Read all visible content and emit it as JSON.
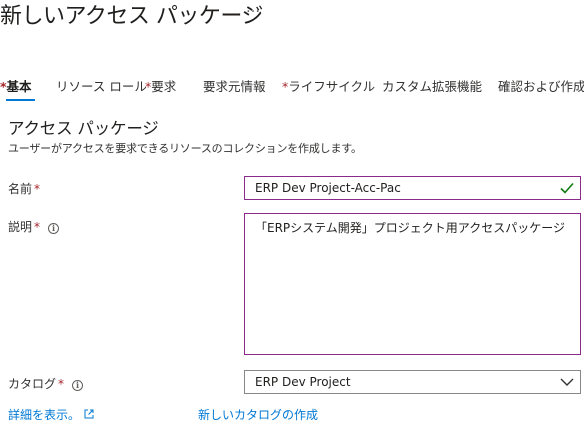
{
  "header": {
    "title": "新しいアクセス パッケージ",
    "more_label": "…"
  },
  "tabs": [
    {
      "label": "基本",
      "required": true,
      "active": true
    },
    {
      "label": "リソース ロール",
      "required": false,
      "active": false
    },
    {
      "label": "要求",
      "required": true,
      "active": false
    },
    {
      "label": "要求元情報",
      "required": false,
      "active": false
    },
    {
      "label": "ライフサイクル",
      "required": true,
      "active": false
    },
    {
      "label": "カスタム拡張機能",
      "required": false,
      "active": false
    },
    {
      "label": "確認および作成",
      "required": false,
      "active": false
    }
  ],
  "required_marker": "*",
  "section": {
    "title": "アクセス パッケージ",
    "description": "ユーザーがアクセスを要求できるリソースのコレクションを作成します。"
  },
  "form": {
    "name": {
      "label": "名前",
      "value": "ERP Dev Project-Acc-Pac",
      "icon": "check-icon"
    },
    "description": {
      "label": "説明",
      "value": "「ERPシステム開発」プロジェクト用アクセスパッケージ",
      "icon": "info-icon"
    },
    "catalog": {
      "label": "カタログ",
      "value": "ERP Dev Project",
      "icon": "chevron-down-icon"
    }
  },
  "links": {
    "details": "詳細を表示。",
    "new_catalog": "新しいカタログの作成"
  },
  "colors": {
    "accent": "#0078d4",
    "required": "#a4262c",
    "valid_border": "#8a2a8a",
    "check": "#107c10"
  }
}
